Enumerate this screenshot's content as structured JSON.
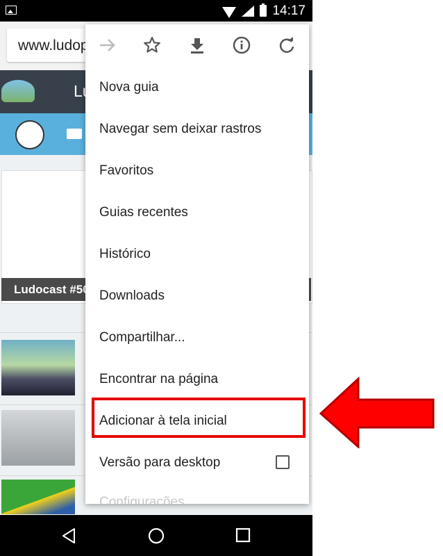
{
  "status_bar": {
    "time": "14:17"
  },
  "browser": {
    "url": "www.ludop"
  },
  "site": {
    "header_letter": "Lu",
    "card_caption": "Ludocast #50"
  },
  "menu": {
    "items": [
      "Nova guia",
      "Navegar sem deixar rastros",
      "Favoritos",
      "Guias recentes",
      "Histórico",
      "Downloads",
      "Compartilhar...",
      "Encontrar na página",
      "Adicionar à tela inicial",
      "Versão para desktop",
      "Configurações"
    ],
    "icons": [
      "forward-icon",
      "star-icon",
      "download-icon",
      "info-icon",
      "reload-icon"
    ]
  },
  "colors": {
    "highlight": "#e60000",
    "arrow": "#ff0000",
    "site_header": "#37404b",
    "site_nav": "#5ab0dd"
  }
}
